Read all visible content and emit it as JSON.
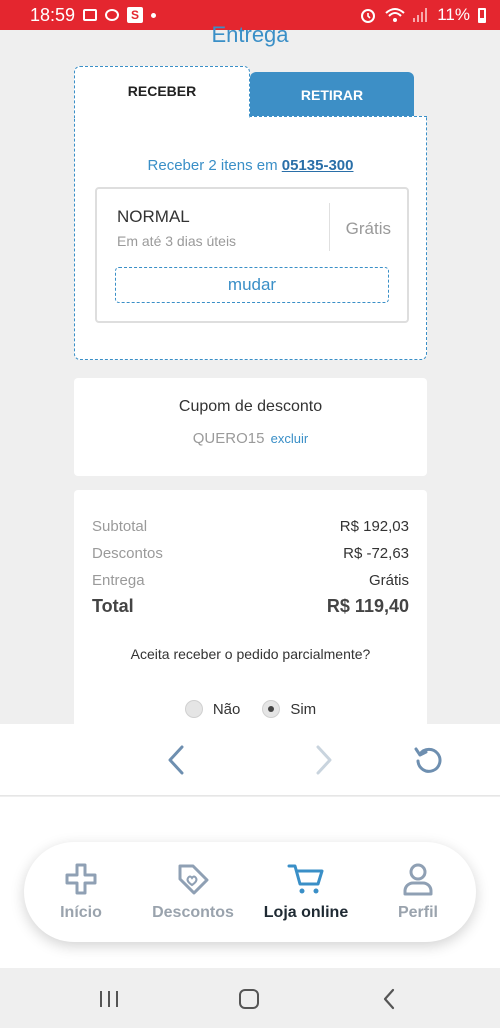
{
  "status_bar": {
    "time": "18:59",
    "battery": "11%"
  },
  "page": {
    "title": "Entrega"
  },
  "delivery": {
    "tabs": [
      {
        "label": "RECEBER",
        "active": true
      },
      {
        "label": "RETIRAR",
        "active": false
      }
    ],
    "receive_prefix": "Receber 2 itens em ",
    "cep": "05135-300",
    "option": {
      "name": "NORMAL",
      "eta": "Em até 3 dias úteis",
      "price": "Grátis",
      "change_label": "mudar"
    }
  },
  "coupon": {
    "title": "Cupom de desconto",
    "code": "QUERO15",
    "remove_label": "excluir"
  },
  "summary": {
    "rows": [
      {
        "label": "Subtotal",
        "value": "R$ 192,03"
      },
      {
        "label": "Descontos",
        "value": "R$ -72,63"
      },
      {
        "label": "Entrega",
        "value": "Grátis"
      }
    ],
    "total_label": "Total",
    "total_value": "R$ 119,40",
    "partial_question": "Aceita receber o pedido parcialmente?",
    "partial_options": [
      {
        "label": "Não",
        "selected": false
      },
      {
        "label": "Sim",
        "selected": true
      }
    ]
  },
  "app_nav": {
    "items": [
      {
        "label": "Início",
        "icon": "plus-cross-icon",
        "active": false
      },
      {
        "label": "Descontos",
        "icon": "tag-heart-icon",
        "active": false
      },
      {
        "label": "Loja online",
        "icon": "cart-icon",
        "active": true
      },
      {
        "label": "Perfil",
        "icon": "user-icon",
        "active": false
      }
    ]
  },
  "colors": {
    "status_bar": "#e4262f",
    "accent": "#3a8fc7",
    "tab_inactive": "#3d8fc6"
  }
}
